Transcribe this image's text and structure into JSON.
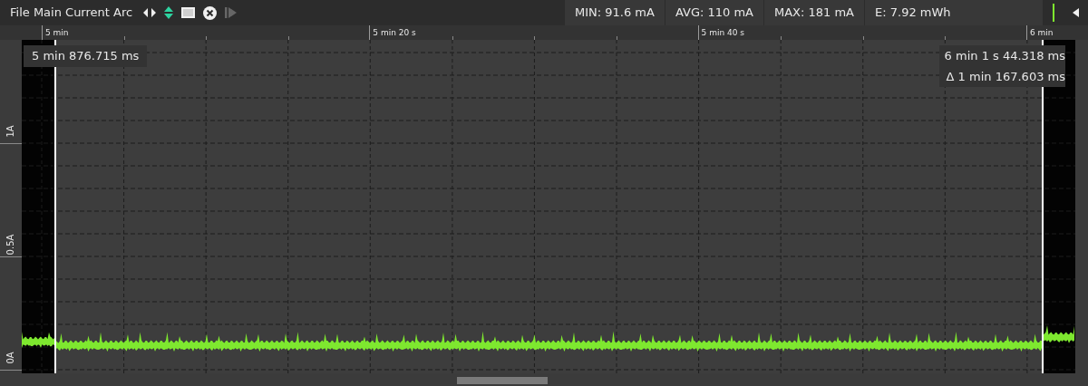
{
  "header": {
    "title": "File Main Current Arc",
    "stats": [
      "MIN: 91.6 mA",
      "AVG: 110 mA",
      "MAX: 181 mA",
      "E: 7.92 mWh"
    ]
  },
  "x_axis": {
    "labels": [
      "5 min",
      "5 min 20 s",
      "5 min 40 s",
      "6 min"
    ]
  },
  "y_axis": {
    "labels": [
      "1A",
      "0.5A",
      "0A"
    ]
  },
  "cursors": {
    "start": "5 min 876.715 ms",
    "end": "6 min 1 s 44.318 ms",
    "delta": "Δ 1 min 167.603 ms"
  }
}
